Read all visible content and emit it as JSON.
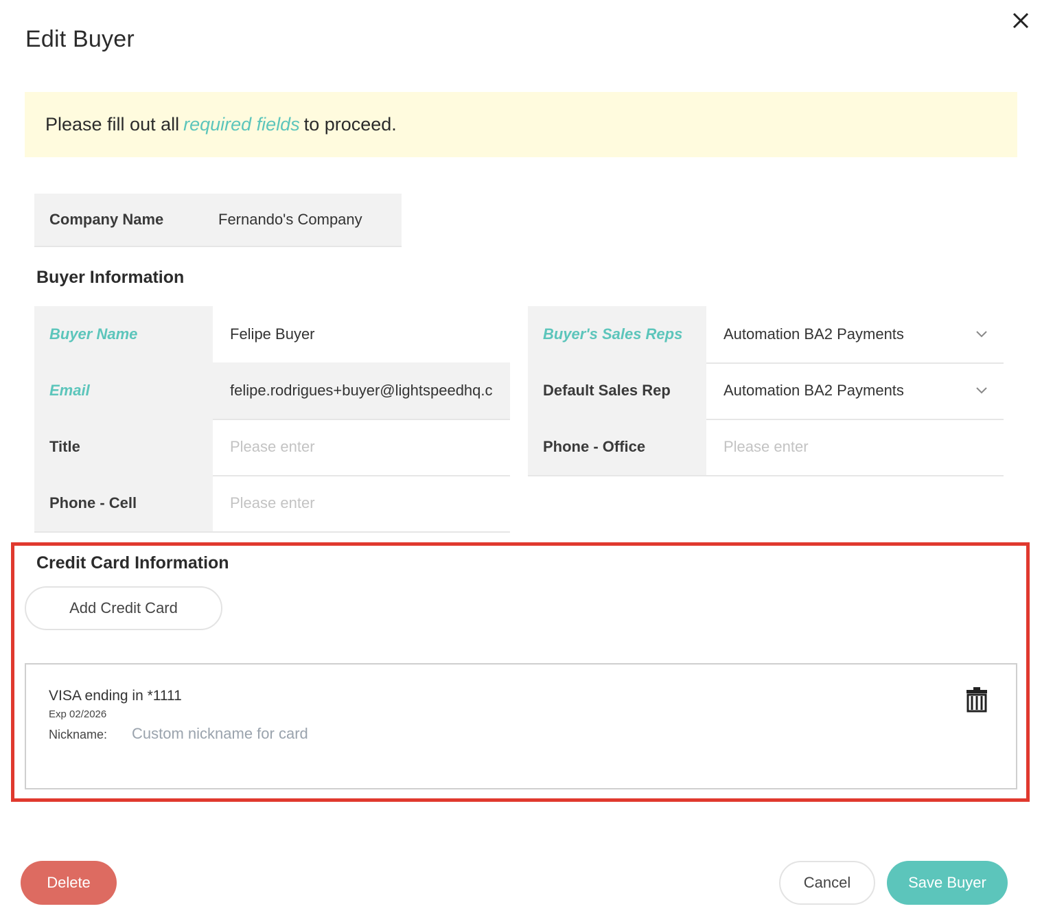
{
  "dialog": {
    "title": "Edit Buyer"
  },
  "notice": {
    "prefix": "Please fill out all",
    "link": "required fields",
    "suffix": "to proceed."
  },
  "company": {
    "label": "Company Name",
    "value": "Fernando's Company"
  },
  "buyer_info": {
    "heading": "Buyer Information",
    "buyer_name_label": "Buyer Name",
    "buyer_name_value": "Felipe Buyer",
    "email_label": "Email",
    "email_value": "felipe.rodrigues+buyer@lightspeedhq.c",
    "title_label": "Title",
    "title_placeholder": "Please enter",
    "phone_cell_label": "Phone - Cell",
    "phone_cell_placeholder": "Please enter",
    "sales_reps_label": "Buyer's Sales Reps",
    "sales_reps_value": "Automation BA2 Payments",
    "default_rep_label": "Default Sales Rep",
    "default_rep_value": "Automation BA2 Payments",
    "phone_office_label": "Phone - Office",
    "phone_office_placeholder": "Please enter"
  },
  "credit_card": {
    "heading": "Credit Card Information",
    "add_label": "Add Credit Card",
    "card": {
      "title": "VISA ending in *1111",
      "exp": "Exp 02/2026",
      "nickname_label": "Nickname:",
      "nickname_placeholder": "Custom nickname for card"
    }
  },
  "footer": {
    "delete_label": "Delete",
    "cancel_label": "Cancel",
    "save_label": "Save Buyer"
  },
  "colors": {
    "accent": "#5cc5bb",
    "danger": "#dd6b61",
    "notice_bg": "#fffbde",
    "highlight": "#e0392e"
  }
}
